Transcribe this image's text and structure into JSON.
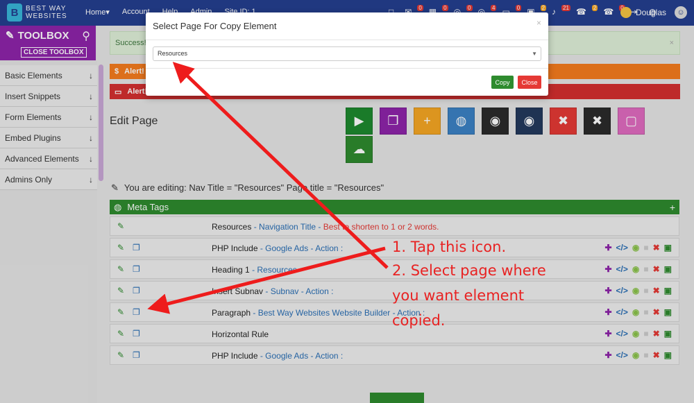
{
  "topnav": {
    "logo_line1": "BEST WAY",
    "logo_line2": "WEBSITES",
    "menu": [
      "Home▾",
      "Account",
      "Help",
      "Admin",
      "Site ID: 1"
    ],
    "icons": [
      {
        "icon": "monitor-icon",
        "glyph": "□",
        "badge": ""
      },
      {
        "icon": "envelope-icon",
        "glyph": "✉",
        "badge": "0"
      },
      {
        "icon": "calendar-icon",
        "glyph": "▦",
        "badge": "0"
      },
      {
        "icon": "cart-icon",
        "glyph": "◎",
        "badge": "0"
      },
      {
        "icon": "cart2-icon",
        "glyph": "◎",
        "badge": "4"
      },
      {
        "icon": "chat-icon",
        "glyph": "▭",
        "badge": "0"
      },
      {
        "icon": "basket-icon",
        "glyph": "▣",
        "badge": "2"
      },
      {
        "icon": "bell-icon",
        "glyph": "♪",
        "badge": "21"
      },
      {
        "icon": "phone-icon",
        "glyph": "☎",
        "badge": "2"
      },
      {
        "icon": "phone2-icon",
        "glyph": "☎",
        "badge": "0"
      },
      {
        "icon": "logout-icon",
        "glyph": "⇥",
        "badge": ""
      },
      {
        "icon": "globe-icon",
        "glyph": "◍",
        "badge": ""
      }
    ],
    "user_name": "Douglas"
  },
  "sidebar": {
    "toolbox_title": "TOOLBOX",
    "close_label": "CLOSE TOOLBOX",
    "items": [
      {
        "label": "Basic Elements"
      },
      {
        "label": "Insert Snippets"
      },
      {
        "label": "Form Elements"
      },
      {
        "label": "Embed Plugins"
      },
      {
        "label": "Advanced Elements"
      },
      {
        "label": "Admins Only"
      }
    ]
  },
  "main": {
    "success_text": "Success!",
    "alert1_text": "Alert! Y",
    "alert2_text": "Alert!",
    "edit_title": "Edit Page",
    "editing_text": "You are editing: Nav Title = \"Resources\" Page title = \"Resources\"",
    "meta_label": "Meta Tags",
    "tool_buttons": [
      {
        "name": "tutorial-button",
        "glyph": "▶",
        "color": "#1e8a2e"
      },
      {
        "name": "copy-page-button",
        "glyph": "❐",
        "color": "#8e24aa"
      },
      {
        "name": "add-page-button",
        "glyph": "+",
        "color": "#f5a623"
      },
      {
        "name": "globe-button",
        "glyph": "◍",
        "color": "#3b82c4"
      },
      {
        "name": "hide-button",
        "glyph": "◉",
        "color": "#2b2b2b"
      },
      {
        "name": "show-button",
        "glyph": "◉",
        "color": "#23395d"
      },
      {
        "name": "delete-red-button",
        "glyph": "✖",
        "color": "#e53935"
      },
      {
        "name": "delete-black-button",
        "glyph": "✖",
        "color": "#2b2b2b"
      },
      {
        "name": "pink-square-button",
        "glyph": "▢",
        "color": "#e06bc0"
      },
      {
        "name": "upload-button",
        "glyph": "☁",
        "color": "#2e8b2e"
      }
    ],
    "rows": [
      {
        "name": "Resources",
        "sub": "- Navigation Title -",
        "note": "Best to shorten to 1 or 2 words.",
        "copy": false,
        "actions": false
      },
      {
        "name": "PHP Include",
        "sub": "- Google Ads - Action :",
        "note": "",
        "copy": true,
        "actions": true
      },
      {
        "name": "Heading 1",
        "sub": "- Resources",
        "note": "",
        "copy": true,
        "actions": true
      },
      {
        "name": "Insert Subnav",
        "sub": "- Subnav - Action :",
        "note": "",
        "copy": true,
        "actions": true
      },
      {
        "name": "Paragraph",
        "sub": "- Best Way Websites Website Builder - Action :",
        "note": "",
        "copy": true,
        "actions": true
      },
      {
        "name": "Horizontal Rule",
        "sub": "",
        "note": "",
        "copy": true,
        "actions": true
      },
      {
        "name": "PHP Include",
        "sub": "- Google Ads - Action :",
        "note": "",
        "copy": true,
        "actions": true
      }
    ],
    "row_actions": [
      {
        "name": "move-icon",
        "glyph": "✚",
        "color": "#8e24aa"
      },
      {
        "name": "code-icon",
        "glyph": "</>",
        "color": "#2a6fb5"
      },
      {
        "name": "eye-icon",
        "glyph": "◉",
        "color": "#8bc34a"
      },
      {
        "name": "square-icon",
        "glyph": "■",
        "color": "#cccccc"
      },
      {
        "name": "trash-icon",
        "glyph": "✖",
        "color": "#e53935"
      },
      {
        "name": "lock-icon",
        "glyph": "▣",
        "color": "#2e8b2e"
      }
    ]
  },
  "modal": {
    "title": "Select Page For Copy Element",
    "close_x": "×",
    "selected": "Resources",
    "copy_label": "Copy",
    "close_label": "Close"
  },
  "annotation": {
    "step1": "1. Tap this icon.",
    "step2_line1": "2. Select page where",
    "step2_line2": "you want element",
    "step2_line3": "copied."
  }
}
